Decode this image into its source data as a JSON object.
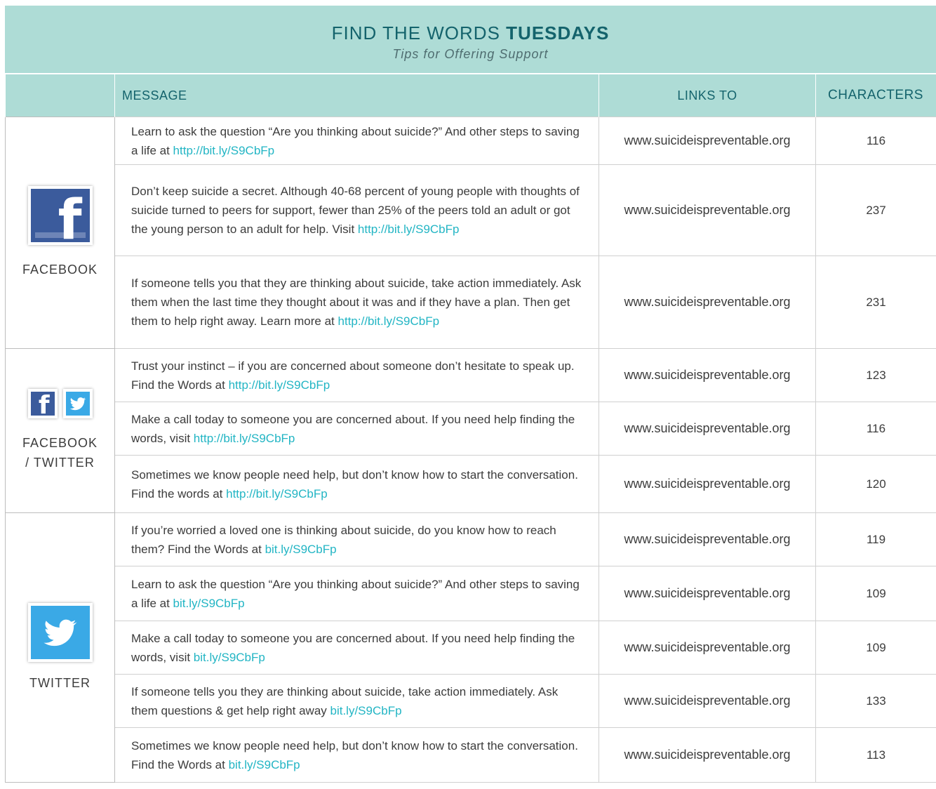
{
  "header": {
    "title_regular": "FIND THE WORDS",
    "title_bold": "TUESDAYS",
    "subtitle": "Tips for Offering Support"
  },
  "columns": {
    "message": "MESSAGE",
    "links_to": "LINKS TO",
    "characters": "CHARACTERS"
  },
  "groups": [
    {
      "label_line1": "FACEBOOK",
      "label_line2": "",
      "icons": [
        "facebook-icon"
      ],
      "rows": [
        {
          "text": "Learn to ask the question “Are you thinking about suicide?” And other steps to saving a life at ",
          "link": "http://bit.ly/S9CbFp",
          "links_to": "www.suicideispreventable.org",
          "chars": "116"
        },
        {
          "text": "Don’t keep suicide a secret. Although 40-68 percent of young people with thoughts of suicide turned to peers for support, fewer than 25% of the peers told an adult or got the young person to an adult for help. Visit ",
          "link": "http://bit.ly/S9CbFp",
          "links_to": "www.suicideispreventable.org",
          "chars": "237"
        },
        {
          "text": "If someone tells you that they are thinking about suicide, take action immediately. Ask them when the last time they thought about it was and if they have a plan. Then get them to help right away. Learn more at ",
          "link": "http://bit.ly/S9CbFp",
          "links_to": "www.suicideispreventable.org",
          "chars": "231"
        }
      ]
    },
    {
      "label_line1": "FACEBOOK",
      "label_line2": "/ TWITTER",
      "icons": [
        "facebook-icon",
        "twitter-icon"
      ],
      "rows": [
        {
          "text": "Trust your instinct – if you are concerned about someone don’t hesitate to speak up. Find the Words at ",
          "link": "http://bit.ly/S9CbFp",
          "links_to": "www.suicideispreventable.org",
          "chars": "123"
        },
        {
          "text": "Make a call today to someone you are concerned about. If you need help finding the words, visit ",
          "link": "http://bit.ly/S9CbFp",
          "links_to": "www.suicideispreventable.org",
          "chars": "116"
        },
        {
          "text": "Sometimes we know people need help, but don’t know how to start the conversation. Find the words at ",
          "link": "http://bit.ly/S9CbFp",
          "links_to": "www.suicideispreventable.org",
          "chars": "120"
        }
      ]
    },
    {
      "label_line1": "TWITTER",
      "label_line2": "",
      "icons": [
        "twitter-icon"
      ],
      "rows": [
        {
          "text": "If you’re worried a loved one is thinking about suicide, do you know how to reach them? Find the Words at ",
          "link": "bit.ly/S9CbFp",
          "links_to": "www.suicideispreventable.org",
          "chars": "119"
        },
        {
          "text": "Learn to ask the question “Are you thinking about suicide?” And other steps to saving a life at ",
          "link": "bit.ly/S9CbFp",
          "links_to": "www.suicideispreventable.org",
          "chars": "109"
        },
        {
          "text": "Make a call today to someone you are concerned about. If you need help finding the words, visit ",
          "link": "bit.ly/S9CbFp",
          "links_to": "www.suicideispreventable.org",
          "chars": "109"
        },
        {
          "text": "If someone tells you they are thinking about suicide, take action immediately. Ask them questions & get help right away ",
          "link": "bit.ly/S9CbFp",
          "links_to": "www.suicideispreventable.org",
          "chars": "133"
        },
        {
          "text": "Sometimes we know people need help, but don’t know how to start the conversation. Find the Words at ",
          "link": "bit.ly/S9CbFp",
          "links_to": "www.suicideispreventable.org",
          "chars": "113"
        }
      ]
    }
  ]
}
